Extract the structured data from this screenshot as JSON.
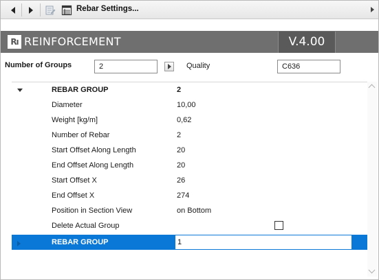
{
  "toolbar": {
    "title": "Rebar Settings...",
    "back_icon": "triangle-left",
    "forward_icon": "triangle-right",
    "edit_icon": "document-edit",
    "settings_icon": "table-document"
  },
  "header": {
    "logo": "Rı",
    "title": "REINFORCEMENT",
    "version": "V.4.00",
    "background": "#6f6f6f"
  },
  "groups": {
    "label": "Number of Groups",
    "value": "2",
    "quality_label": "Quality",
    "quality_value": "C636"
  },
  "grid": {
    "group1": {
      "name": "REBAR GROUP",
      "value": "2"
    },
    "properties": [
      {
        "name": "Diameter",
        "value": "10,00"
      },
      {
        "name": "Weight [kg/m]",
        "value": "0,62"
      },
      {
        "name": "Number of Rebar",
        "value": "2"
      },
      {
        "name": "Start Offset Along Length",
        "value": "20"
      },
      {
        "name": "End Offset Along Length",
        "value": "20"
      },
      {
        "name": "Start Offset X",
        "value": "26"
      },
      {
        "name": "End Offset X",
        "value": "274"
      },
      {
        "name": "Position in Section View",
        "value": "on Bottom"
      },
      {
        "name": "Delete Actual Group",
        "value": ""
      }
    ],
    "group2": {
      "name": "REBAR GROUP",
      "value": "1"
    },
    "delete_checked": false,
    "selection_color": "#0a78d7"
  }
}
